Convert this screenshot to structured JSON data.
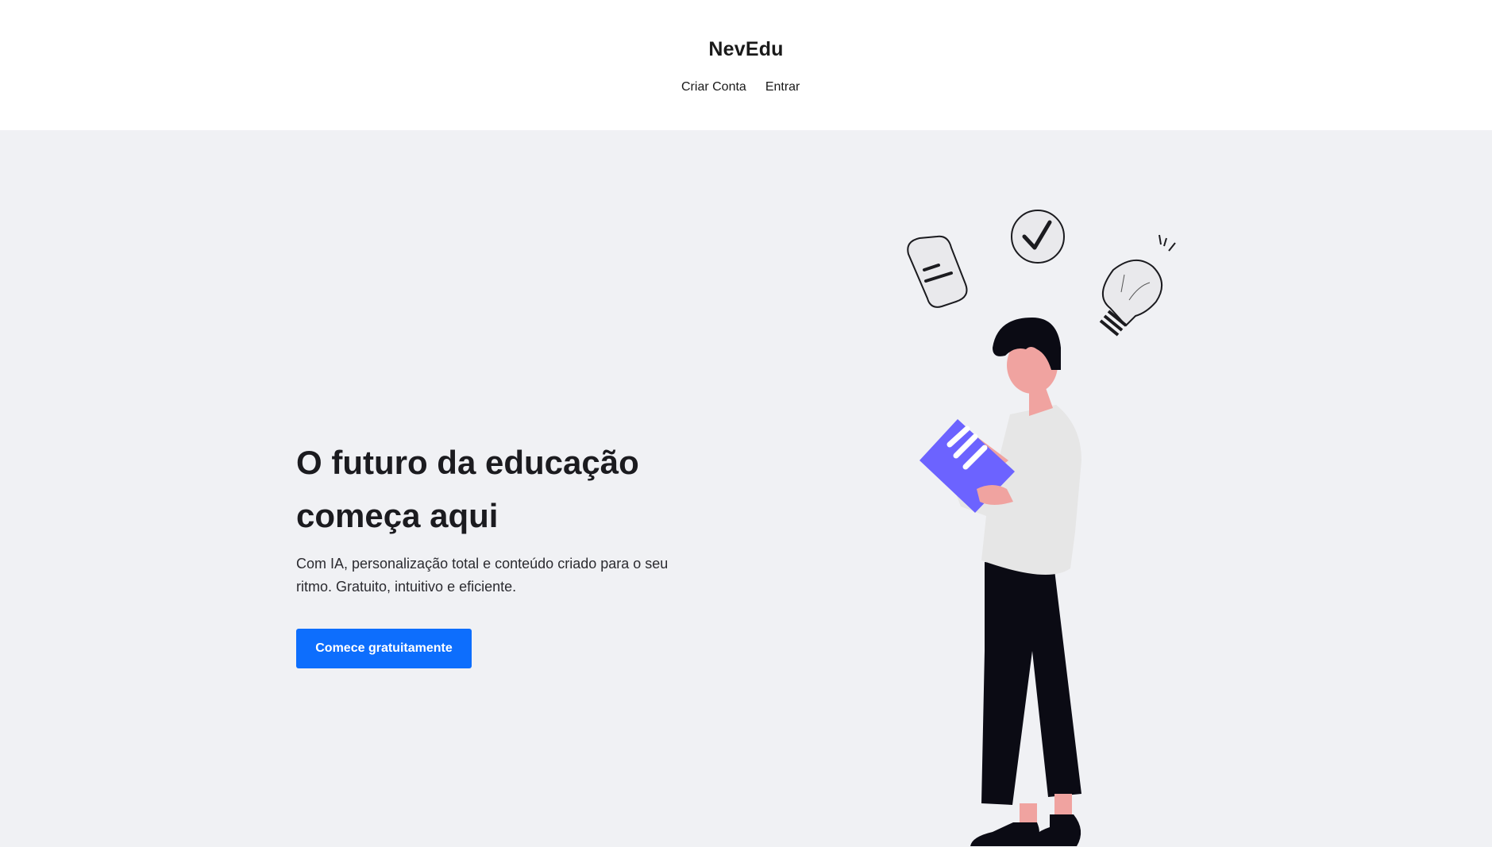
{
  "header": {
    "brand": "NevEdu",
    "nav": {
      "create_account": "Criar Conta",
      "login": "Entrar"
    }
  },
  "hero": {
    "headline_line1": "O futuro da educação",
    "headline_line2": "começa aqui",
    "subtitle": "Com IA, personalização total e conteúdo criado para o seu ritmo. Gratuito, intuitivo e eficiente.",
    "cta_label": "Comece gratuitamente"
  },
  "colors": {
    "accent": "#0d6efd",
    "hero_bg": "#f0f1f4",
    "book": "#6c63ff",
    "skin": "#f0a3a0",
    "shirt": "#e6e6e6",
    "pants": "#0b0b14"
  },
  "illustration": {
    "icons": [
      "document-icon",
      "checkmark-icon",
      "lightbulb-icon"
    ]
  }
}
